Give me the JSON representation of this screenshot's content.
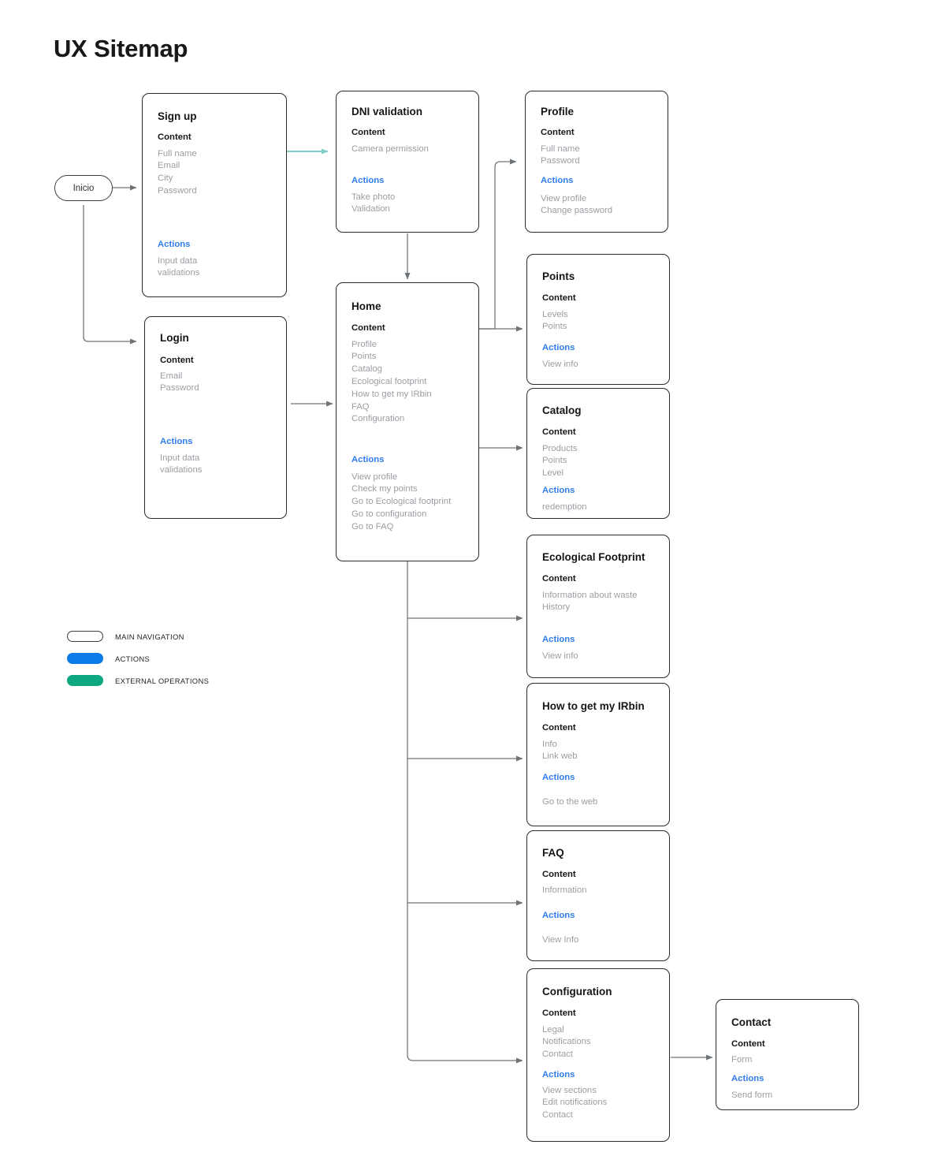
{
  "page": {
    "title": "UX Sitemap"
  },
  "start_node": {
    "label": "Inicio",
    "shape": "rounded-pill"
  },
  "section_labels": {
    "content": "Content",
    "actions": "Actions"
  },
  "colors": {
    "card_border": "#2b2b2b",
    "title_text": "#15161a",
    "item_text": "#9a9ea3",
    "actions_accent": "#2f7ded",
    "edge": "#6e7377",
    "external_edge": "#7ecfc8",
    "legend_actions": "#0b7bea",
    "legend_external": "#0da87f"
  },
  "cards": [
    {
      "id": "signup",
      "title": "Sign up",
      "content": [
        "Full name",
        "Email",
        "City",
        "Password"
      ],
      "actions": [
        "Input data",
        "validations"
      ]
    },
    {
      "id": "dni",
      "title": "DNI  validation",
      "content": [
        "Camera permission"
      ],
      "actions": [
        "Take photo",
        "Validation"
      ]
    },
    {
      "id": "profile",
      "title": "Profile",
      "content": [
        "Full name",
        "Password"
      ],
      "actions": [
        "View profile",
        "Change password"
      ]
    },
    {
      "id": "login",
      "title": "Login",
      "content": [
        "Email",
        "Password"
      ],
      "actions": [
        "Input data",
        "validations"
      ]
    },
    {
      "id": "home",
      "title": "Home",
      "content": [
        "Profile",
        "Points",
        "Catalog",
        "Ecological footprint",
        "How to get my IRbin",
        "FAQ",
        "Configuration"
      ],
      "actions": [
        "View profile",
        "Check my points",
        "Go to Ecological footprint",
        "Go to configuration",
        "Go to FAQ"
      ]
    },
    {
      "id": "points",
      "title": "Points",
      "content": [
        "Levels",
        "Points"
      ],
      "actions": [
        "View info"
      ]
    },
    {
      "id": "catalog",
      "title": "Catalog",
      "content": [
        "Products",
        "Points",
        "Level"
      ],
      "actions": [
        "redemption"
      ]
    },
    {
      "id": "ecofootprint",
      "title": "Ecological Footprint",
      "content": [
        "Information about waste",
        "History"
      ],
      "actions": [
        "View info"
      ]
    },
    {
      "id": "irbin",
      "title": "How to get my IRbin",
      "content": [
        "Info",
        "Link web"
      ],
      "actions": [
        "Go to the web"
      ]
    },
    {
      "id": "faq",
      "title": "FAQ",
      "content": [
        "Information"
      ],
      "actions": [
        "View Info"
      ]
    },
    {
      "id": "configuration",
      "title": "Configuration",
      "content": [
        "Legal",
        "Notifications",
        "Contact"
      ],
      "actions": [
        "View sections",
        "Edit notifications",
        "Contact"
      ]
    },
    {
      "id": "contact",
      "title": "Contact",
      "content": [
        "Form"
      ],
      "actions": [
        "Send form"
      ]
    }
  ],
  "legend": [
    {
      "label": "MAIN NAVIGATION",
      "style": "outline",
      "color": "#ffffff"
    },
    {
      "label": "ACTIONS",
      "style": "filled",
      "color": "#0b7bea"
    },
    {
      "label": "EXTERNAL OPERATIONS",
      "style": "filled",
      "color": "#0da87f"
    }
  ]
}
